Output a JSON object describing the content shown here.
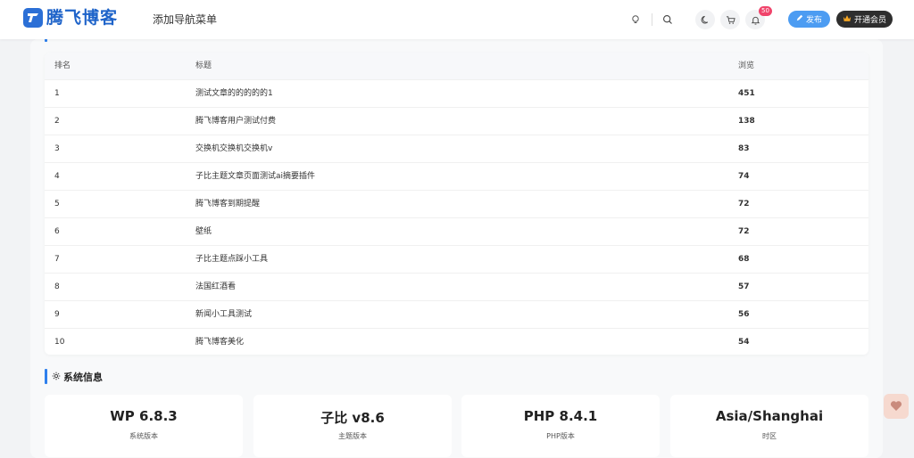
{
  "header": {
    "logo_text": "腾飞博客",
    "nav_menu_label": "添加导航菜单",
    "notification_count": "50",
    "publish_label": "发布",
    "vip_label": "开通会员"
  },
  "ranking_table": {
    "columns": {
      "rank": "排名",
      "title": "标题",
      "views": "浏览"
    },
    "rows": [
      {
        "rank": "1",
        "title": "测试文章的的的的的1",
        "views": "451"
      },
      {
        "rank": "2",
        "title": "腾飞博客用户测试付费",
        "views": "138"
      },
      {
        "rank": "3",
        "title": "交换机交换机交换机v",
        "views": "83"
      },
      {
        "rank": "4",
        "title": "子比主题文章页面测试ai摘要插件",
        "views": "74"
      },
      {
        "rank": "5",
        "title": "腾飞博客到期提醒",
        "views": "72"
      },
      {
        "rank": "6",
        "title": "壁纸",
        "views": "72"
      },
      {
        "rank": "7",
        "title": "子比主题点踩小工具",
        "views": "68"
      },
      {
        "rank": "8",
        "title": "法国红酒看",
        "views": "57"
      },
      {
        "rank": "9",
        "title": "新闻小工具测试",
        "views": "56"
      },
      {
        "rank": "10",
        "title": "腾飞博客美化",
        "views": "54"
      }
    ]
  },
  "system_info": {
    "title": "系统信息",
    "cards": [
      {
        "value": "WP 6.8.3",
        "label": "系统版本"
      },
      {
        "value": "子比 v8.6",
        "label": "主题版本"
      },
      {
        "value": "PHP 8.4.1",
        "label": "PHP版本"
      },
      {
        "value": "Asia/Shanghai",
        "label": "时区"
      }
    ]
  },
  "colors": {
    "brand": "#1e63c9",
    "accent": "#2f80ed",
    "publish_button": "#4c9cf2",
    "vip_button": "#2e2e2e",
    "badge": "#f0446b"
  },
  "icons": [
    "logo-icon",
    "lightbulb-icon",
    "search-icon",
    "moon-icon",
    "cart-icon",
    "bell-icon",
    "pencil-icon",
    "crown-icon",
    "gear-icon",
    "heart-icon"
  ]
}
